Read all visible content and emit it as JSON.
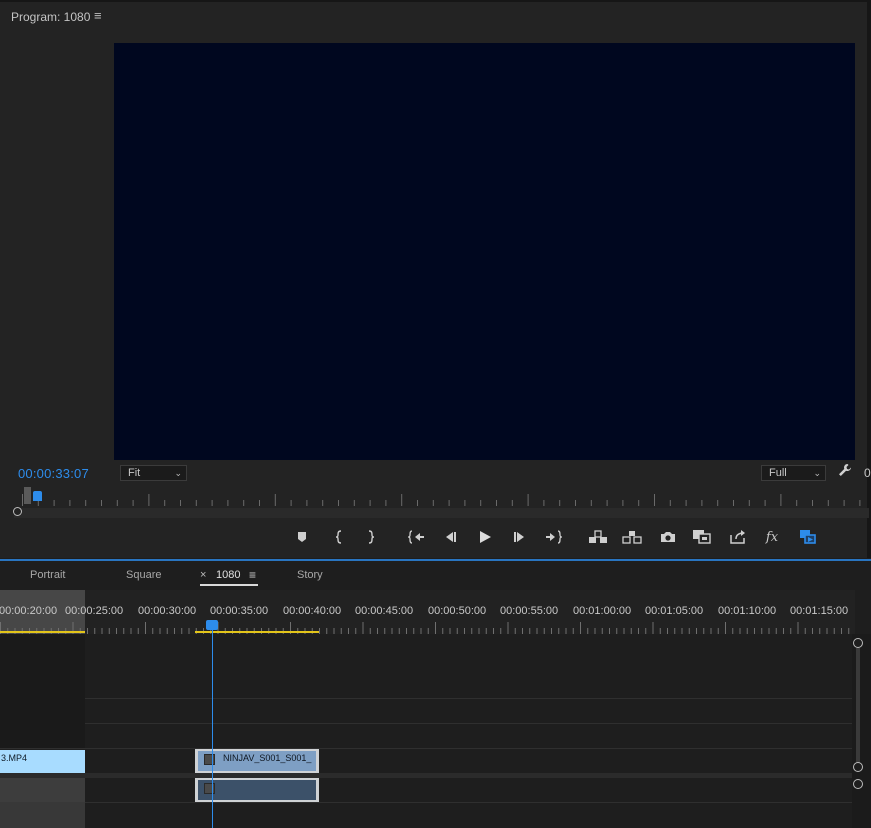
{
  "program_monitor": {
    "title": "Program: 1080",
    "menu_icon": "hamburger-icon",
    "timecode": "00:00:33:07",
    "fit_dropdown": {
      "selected": "Fit"
    },
    "quality_dropdown": {
      "selected": "Full"
    },
    "wrench_icon": "wrench-icon",
    "edge_text": "0",
    "transport_buttons": [
      {
        "name": "add-marker-button",
        "icon": "marker-icon"
      },
      {
        "name": "mark-in-button",
        "icon": "mark-in-icon"
      },
      {
        "name": "mark-out-button",
        "icon": "mark-out-icon"
      },
      {
        "name": "go-to-in-button",
        "icon": "go-to-in-icon"
      },
      {
        "name": "step-back-button",
        "icon": "step-back-icon"
      },
      {
        "name": "play-button",
        "icon": "play-icon"
      },
      {
        "name": "step-forward-button",
        "icon": "step-forward-icon"
      },
      {
        "name": "go-to-out-button",
        "icon": "go-to-out-icon"
      },
      {
        "name": "lift-button",
        "icon": "lift-icon"
      },
      {
        "name": "extract-button",
        "icon": "extract-icon"
      },
      {
        "name": "export-frame-button",
        "icon": "camera-icon"
      },
      {
        "name": "comparison-view-button",
        "icon": "comparison-icon"
      },
      {
        "name": "share-button",
        "icon": "share-icon"
      },
      {
        "name": "fx-button",
        "icon": "fx-icon",
        "label": "fx"
      },
      {
        "name": "multi-camera-button",
        "icon": "multicam-icon"
      }
    ]
  },
  "timeline": {
    "tabs": [
      {
        "label": "Portrait",
        "active": false
      },
      {
        "label": "Square",
        "active": false
      },
      {
        "label": "1080",
        "active": true
      },
      {
        "label": "Story",
        "active": false
      }
    ],
    "close_glyph": "×",
    "menu_glyph": "≡",
    "ruler_labels": [
      "00:00:20:00",
      "00:00:25:00",
      "00:00:30:00",
      "00:00:35:00",
      "00:00:40:00",
      "00:00:45:00",
      "00:00:50:00",
      "00:00:55:00",
      "00:01:00:00",
      "00:01:05:00",
      "00:01:10:00",
      "00:01:15:00"
    ],
    "clips": {
      "left_clip_label": "3.MP4",
      "video_clip_label": "NINJAV_S001_S001_"
    },
    "colors": {
      "playhead": "#2d8ceb",
      "work_area": "#e3c51a",
      "video_clip": "#7e9fc4",
      "audio_clip": "#3c5169"
    }
  }
}
